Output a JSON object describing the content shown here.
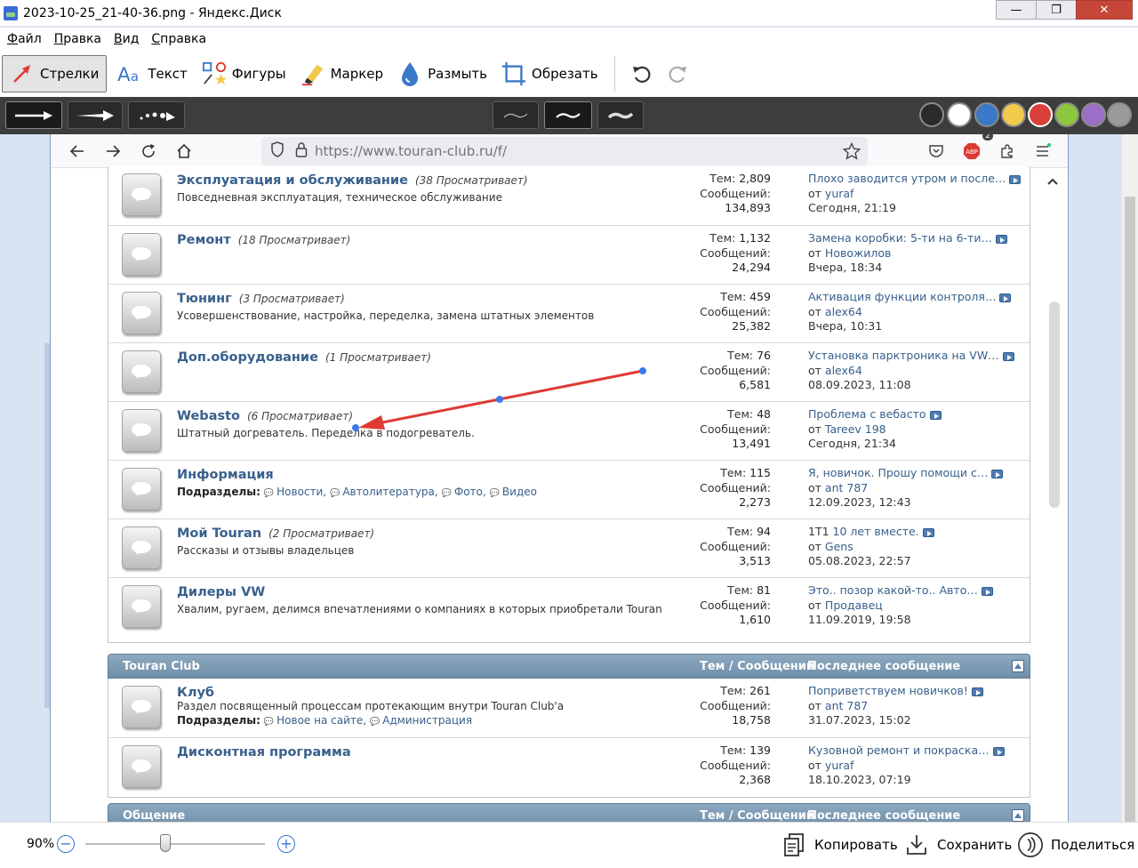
{
  "window": {
    "title": "2023-10-25_21-40-36.png - Яндекс.Диск",
    "minimize": "—",
    "maximize": "❐",
    "close": "✕"
  },
  "menu": [
    "Файл",
    "Правка",
    "Вид",
    "Справка"
  ],
  "tools": {
    "arrows": "Стрелки",
    "text": "Текст",
    "shapes": "Фигуры",
    "marker": "Маркер",
    "blur": "Размыть",
    "crop": "Обрезать"
  },
  "colors": {
    "palette": [
      "#2b2b2b",
      "#ffffff",
      "#3a78c8",
      "#f2c94c",
      "#d9403a",
      "#8dc63f",
      "#9b6ec7",
      "#9a9a9a"
    ],
    "selected": "#d9403a",
    "link": "#38608c",
    "annotation_arrow": "#e03a34",
    "annotation_handle": "#3a78e8"
  },
  "browser": {
    "url": "https://www.touran-club.ru/f/",
    "adblock_badge": "2",
    "adblock_label": "ABP"
  },
  "forums": [
    {
      "title": "Эксплуатация и обслуживание",
      "viewers": "(38 Просматривает)",
      "desc": "Повседневная эксплуатация, техническое обслуживание",
      "topics_label": "Тем:",
      "topics": "2,809",
      "posts_label": "Сообщений:",
      "posts": "134,893",
      "last_title": "Плохо заводится утром и после…",
      "last_by": "от",
      "last_user": "yuraf",
      "last_date": "Сегодня, 21:19"
    },
    {
      "title": "Ремонт",
      "viewers": "(18 Просматривает)",
      "desc": "",
      "topics_label": "Тем:",
      "topics": "1,132",
      "posts_label": "Сообщений:",
      "posts": "24,294",
      "last_title": "Замена коробки: 5-ти на 6-ти…",
      "last_by": "от",
      "last_user": "Новожилов",
      "last_date": "Вчера, 18:34"
    },
    {
      "title": "Тюнинг",
      "viewers": "(3 Просматривает)",
      "desc": "Усовершенствование, настройка, переделка, замена штатных элементов",
      "topics_label": "Тем:",
      "topics": "459",
      "posts_label": "Сообщений:",
      "posts": "25,382",
      "last_title": "Активация функции контроля…",
      "last_by": "от",
      "last_user": "alex64",
      "last_date": "Вчера, 10:31"
    },
    {
      "title": "Доп.оборудование",
      "viewers": "(1 Просматривает)",
      "desc": "",
      "topics_label": "Тем:",
      "topics": "76",
      "posts_label": "Сообщений:",
      "posts": "6,581",
      "last_title": "Установка парктроника на VW…",
      "last_by": "от",
      "last_user": "alex64",
      "last_date": "08.09.2023, 11:08"
    },
    {
      "title": "Webasto",
      "viewers": "(6 Просматривает)",
      "desc": "Штатный догреватель. Переделка в подогреватель.",
      "topics_label": "Тем:",
      "topics": "48",
      "posts_label": "Сообщений:",
      "posts": "13,491",
      "last_title": "Проблема с вебасто",
      "last_by": "от",
      "last_user": "Tareev 198",
      "last_date": "Сегодня, 21:34"
    },
    {
      "title": "Информация",
      "viewers": "",
      "subs_label": "Подразделы:",
      "subs": [
        "Новости,",
        "Автолитература,",
        "Фото,",
        "Видео"
      ],
      "topics_label": "Тем:",
      "topics": "115",
      "posts_label": "Сообщений:",
      "posts": "2,273",
      "last_title": "Я, новичок. Прошу помощи с…",
      "last_by": "от",
      "last_user": "ant 787",
      "last_date": "12.09.2023, 12:43"
    },
    {
      "title": "Мой Touran",
      "viewers": "(2 Просматривает)",
      "desc": "Рассказы и отзывы владельцев",
      "topics_label": "Тем:",
      "topics": "94",
      "posts_label": "Сообщений:",
      "posts": "3,513",
      "last_title_plain": "1T1",
      "last_title": "10 лет вместе.",
      "last_by": "от",
      "last_user": "Gens",
      "last_date": "05.08.2023, 22:57"
    },
    {
      "title": "Дилеры VW",
      "viewers": "",
      "desc": "Хвалим, ругаем, делимся впечатлениями о компаниях в которых приобретали Touran",
      "topics_label": "Тем:",
      "topics": "81",
      "posts_label": "Сообщений:",
      "posts": "1,610",
      "last_title": "Это.. позор какой-то.. Авто…",
      "last_by": "от",
      "last_user": "Продавец",
      "last_date": "11.09.2019, 19:58"
    }
  ],
  "category_club": {
    "name": "Touran Club",
    "cols": "Тем / Сообщений",
    "cols2": "Последнее сообщение",
    "forums": [
      {
        "title": "Клуб",
        "desc": "Раздел посвященный процессам протекающим внутри Touran Club'a",
        "subs_label": "Подразделы:",
        "subs": [
          "Новое на сайте,",
          "Администрация"
        ],
        "topics_label": "Тем:",
        "topics": "261",
        "posts_label": "Сообщений:",
        "posts": "18,758",
        "last_title": "Поприветствуем новичков!",
        "last_by": "от",
        "last_user": "ant 787",
        "last_date": "31.07.2023, 15:02"
      },
      {
        "title": "Дисконтная программа",
        "desc": "",
        "topics_label": "Тем:",
        "topics": "139",
        "posts_label": "Сообщений:",
        "posts": "2,368",
        "last_title": "Кузовной ремонт и покраска…",
        "last_by": "от",
        "last_user": "yuraf",
        "last_date": "18.10.2023, 07:19"
      }
    ]
  },
  "category_general": {
    "name": "Общение",
    "cols": "Тем / Сообщений",
    "cols2": "Последнее сообщение"
  },
  "bottom": {
    "zoom": "90%",
    "zoom_level_percent": 90,
    "copy": "Копировать",
    "save": "Сохранить",
    "share": "Поделиться"
  }
}
